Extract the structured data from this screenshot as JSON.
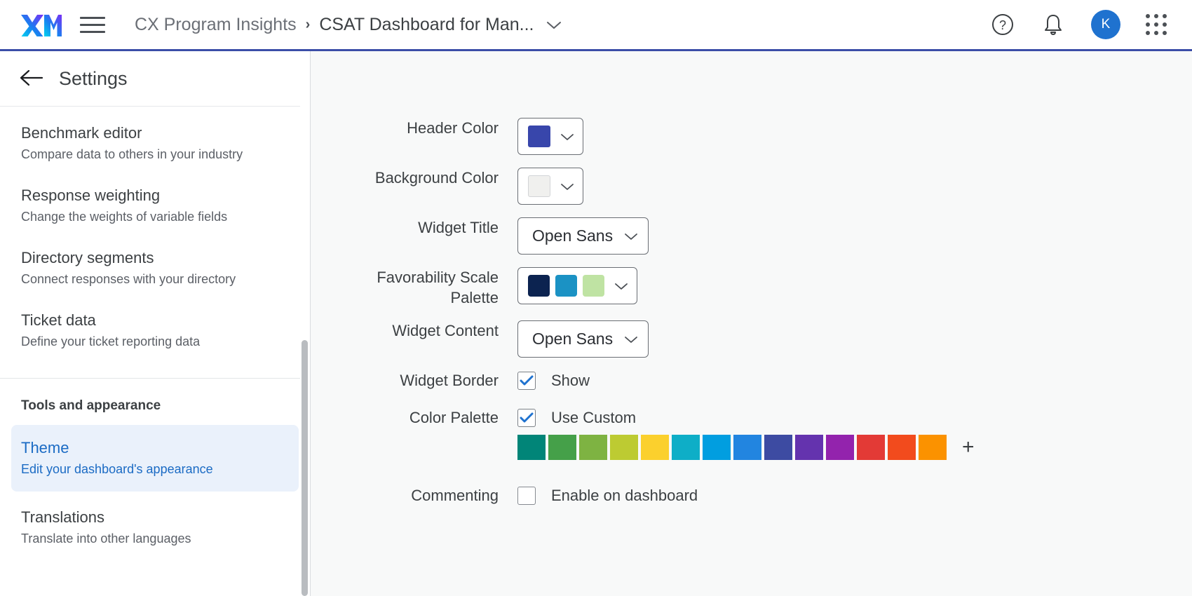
{
  "topbar": {
    "logo_alt": "XM",
    "menu_icon": "hamburger-icon",
    "breadcrumb_root": "CX Program Insights",
    "breadcrumb_separator": "›",
    "breadcrumb_current": "CSAT Dashboard for Man...",
    "breadcrumb_caret": "⌄",
    "help_icon": "question-mark-circle-icon",
    "notifications_icon": "bell-icon",
    "avatar_initial": "K",
    "apps_icon": "grid-apps-icon",
    "accent_underline": "#3b4ea8",
    "avatar_color": "#1f72cf"
  },
  "sidebar": {
    "back_icon": "back-arrow-icon",
    "title": "Settings",
    "items": [
      {
        "title": "Benchmark editor",
        "subtitle": "Compare data to others in your industry",
        "active": false
      },
      {
        "title": "Response weighting",
        "subtitle": "Change the weights of variable fields",
        "active": false
      },
      {
        "title": "Directory segments",
        "subtitle": "Connect responses with your directory",
        "active": false
      },
      {
        "title": "Ticket data",
        "subtitle": "Define your ticket reporting data",
        "active": false
      }
    ],
    "group_label": "Tools and appearance",
    "group_items": [
      {
        "title": "Theme",
        "subtitle": "Edit your dashboard's appearance",
        "active": true
      },
      {
        "title": "Translations",
        "subtitle": "Translate into other languages",
        "active": false
      }
    ],
    "active_bg": "#eaf1fb",
    "active_text": "#1b6bc4"
  },
  "main": {
    "header_color": {
      "label": "Header Color",
      "value": "#3846ab",
      "caret": "⌄"
    },
    "background_color": {
      "label": "Background Color",
      "value": "#f0f0ee",
      "caret": "⌄"
    },
    "widget_title": {
      "label": "Widget Title",
      "value": "Open Sans",
      "caret": "⌄"
    },
    "favorability_scale_palette": {
      "label_line1": "Favorability Scale",
      "label_line2": "Palette",
      "colors": [
        "#0c2350",
        "#1b92c4",
        "#bfe3a3"
      ],
      "caret": "⌄"
    },
    "widget_content": {
      "label": "Widget Content",
      "value": "Open Sans",
      "caret": "⌄"
    },
    "widget_border": {
      "label": "Widget Border",
      "checkbox_label": "Show",
      "checked": true
    },
    "color_palette": {
      "label": "Color Palette",
      "checkbox_label": "Use Custom",
      "checked": true,
      "colors": [
        "#018578",
        "#45a049",
        "#7eb342",
        "#bdcb32",
        "#fbd02d",
        "#0eaec7",
        "#019ee0",
        "#2285e0",
        "#3d4ba2",
        "#6433ae",
        "#9323ad",
        "#e33a36",
        "#f24b1d",
        "#fb9200"
      ],
      "add_label": "+"
    },
    "commenting": {
      "label": "Commenting",
      "checkbox_label": "Enable on dashboard",
      "checked": false
    },
    "checkbox_accent": "#1f72cf",
    "panel_bg": "#f8f9f9"
  }
}
